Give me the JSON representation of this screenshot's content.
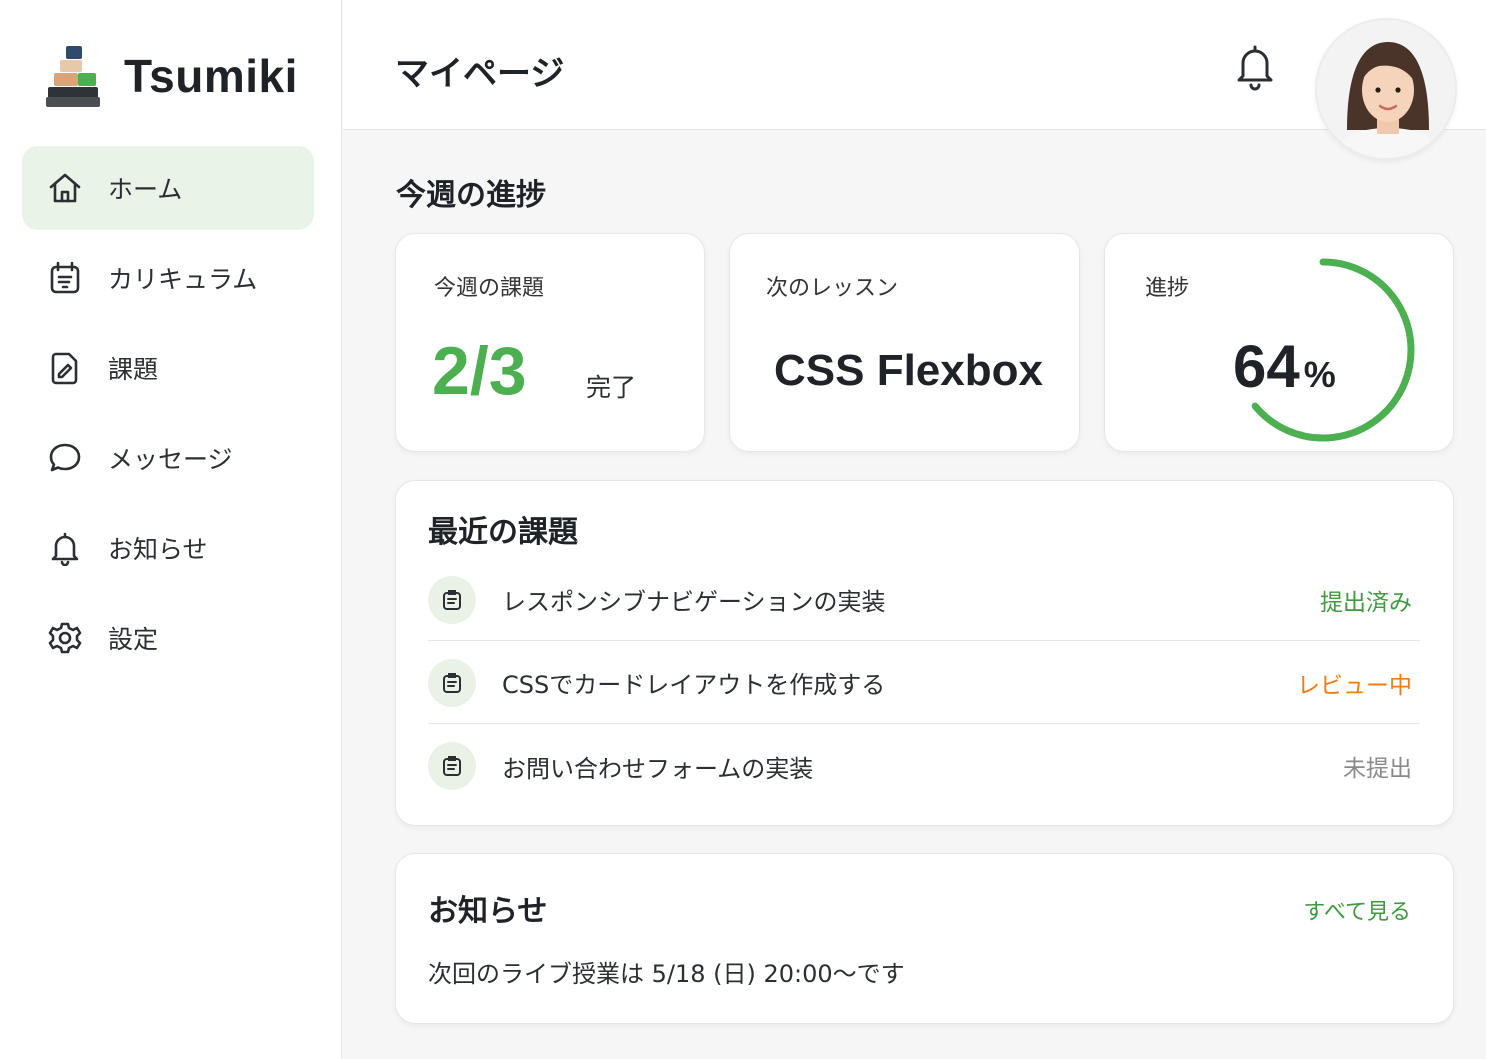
{
  "app": {
    "name": "Tsumiki"
  },
  "sidebar": {
    "items": [
      {
        "label": "ホーム",
        "icon": "home-icon",
        "active": true
      },
      {
        "label": "カリキュラム",
        "icon": "calendar-icon",
        "active": false
      },
      {
        "label": "課題",
        "icon": "assignment-icon",
        "active": false
      },
      {
        "label": "メッセージ",
        "icon": "chat-icon",
        "active": false
      },
      {
        "label": "お知らせ",
        "icon": "bell-icon",
        "active": false
      },
      {
        "label": "設定",
        "icon": "gear-icon",
        "active": false
      }
    ]
  },
  "header": {
    "title": "マイページ",
    "notification_icon": "bell-icon",
    "avatar": "user-avatar"
  },
  "progress": {
    "title": "今週の進捗",
    "tasks": {
      "label": "今週の課題",
      "value": "2/3",
      "suffix": "完了"
    },
    "next_lesson": {
      "label": "次のレッスン",
      "value": "CSS Flexbox"
    },
    "overall": {
      "label": "進捗",
      "value": "64",
      "unit": "%",
      "percent": 64
    }
  },
  "recent": {
    "title": "最近の課題",
    "rows": [
      {
        "text": "レスポンシブナビゲーションの実装",
        "status": "提出済み",
        "status_color": "#3f9a3f"
      },
      {
        "text": "CSSでカードレイアウトを作成する",
        "status": "レビュー中",
        "status_color": "#ef7d12"
      },
      {
        "text": "お問い合わせフォームの実装",
        "status": "未提出",
        "status_color": "#8a8a8a"
      }
    ]
  },
  "news": {
    "title": "お知らせ",
    "see_all": "すべて見る",
    "body": "次回のライブ授業は 5/18 (日) 20:00〜です"
  },
  "colors": {
    "accent": "#4caf50",
    "active_bg": "#e9f3e7",
    "review": "#ef7d12",
    "muted": "#8a8a8a"
  }
}
